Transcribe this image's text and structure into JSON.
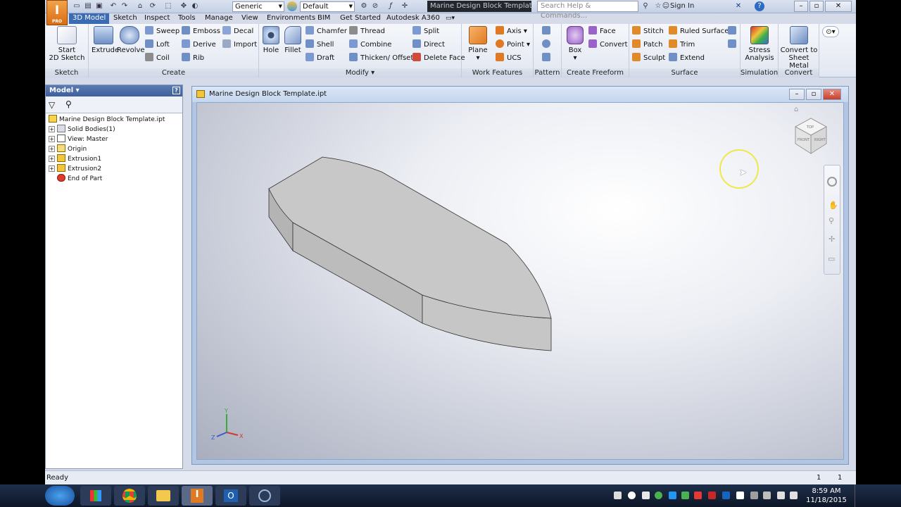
{
  "quick_access": {
    "appearance_select": "Generic",
    "material_select": "Default",
    "window_title": "Marine Design Block Template.ipt",
    "search_placeholder": "Search Help & Commands...",
    "sign_in": "Sign In",
    "logo_letter": "I",
    "logo_sub": "PRO"
  },
  "tabs": [
    "3D Model",
    "Sketch",
    "Inspect",
    "Tools",
    "Manage",
    "View",
    "Environments",
    "BIM",
    "Get Started",
    "Autodesk A360"
  ],
  "active_tab": "3D Model",
  "ribbon": {
    "sketch": {
      "title": "Sketch",
      "start_line1": "Start",
      "start_line2": "2D Sketch"
    },
    "create": {
      "title": "Create",
      "extrude": "Extrude",
      "revolve": "Revolve",
      "sweep": "Sweep",
      "emboss": "Emboss",
      "decal": "Decal",
      "loft": "Loft",
      "derive": "Derive",
      "import": "Import",
      "coil": "Coil",
      "rib": "Rib"
    },
    "modify": {
      "title": "Modify",
      "hole": "Hole",
      "fillet": "Fillet",
      "chamfer": "Chamfer",
      "thread": "Thread",
      "split": "Split",
      "shell": "Shell",
      "combine": "Combine",
      "direct": "Direct",
      "draft": "Draft",
      "thicken": "Thicken/ Offset",
      "delete_face": "Delete Face"
    },
    "work_features": {
      "title": "Work Features",
      "plane": "Plane",
      "axis": "Axis",
      "point": "Point",
      "ucs": "UCS"
    },
    "pattern": {
      "title": "Pattern"
    },
    "freeform": {
      "title": "Create Freeform",
      "box": "Box",
      "face": "Face",
      "convert": "Convert"
    },
    "surface": {
      "title": "Surface",
      "stitch": "Stitch",
      "ruled": "Ruled Surface",
      "patch": "Patch",
      "trim": "Trim",
      "sculpt": "Sculpt",
      "extend": "Extend"
    },
    "simulation": {
      "title": "Simulation",
      "stress_line1": "Stress",
      "stress_line2": "Analysis"
    },
    "convert": {
      "title": "Convert",
      "line1": "Convert to",
      "line2": "Sheet Metal"
    }
  },
  "browser": {
    "header": "Model",
    "items": [
      {
        "label": "Marine Design Block Template.ipt"
      },
      {
        "label": "Solid Bodies(1)"
      },
      {
        "label": "View: Master"
      },
      {
        "label": "Origin"
      },
      {
        "label": "Extrusion1"
      },
      {
        "label": "Extrusion2"
      },
      {
        "label": "End of Part"
      }
    ]
  },
  "document": {
    "title": "Marine Design Block Template.ipt"
  },
  "viewcube": {
    "top": "TOP",
    "front": "FRONT",
    "right": "RIGHT"
  },
  "triad": {
    "x": "X",
    "y": "Y",
    "z": "Z"
  },
  "status": {
    "text": "Ready",
    "count1": "1",
    "count2": "1"
  },
  "taskbar": {
    "time": "8:59 AM",
    "date": "11/18/2015"
  },
  "colors": {
    "ribbon_active_tab": "#3a6bb3",
    "browser_header": "#4b6ba8",
    "cursor_highlight": "#f0e84a",
    "part_face": "#c8c8c8"
  }
}
